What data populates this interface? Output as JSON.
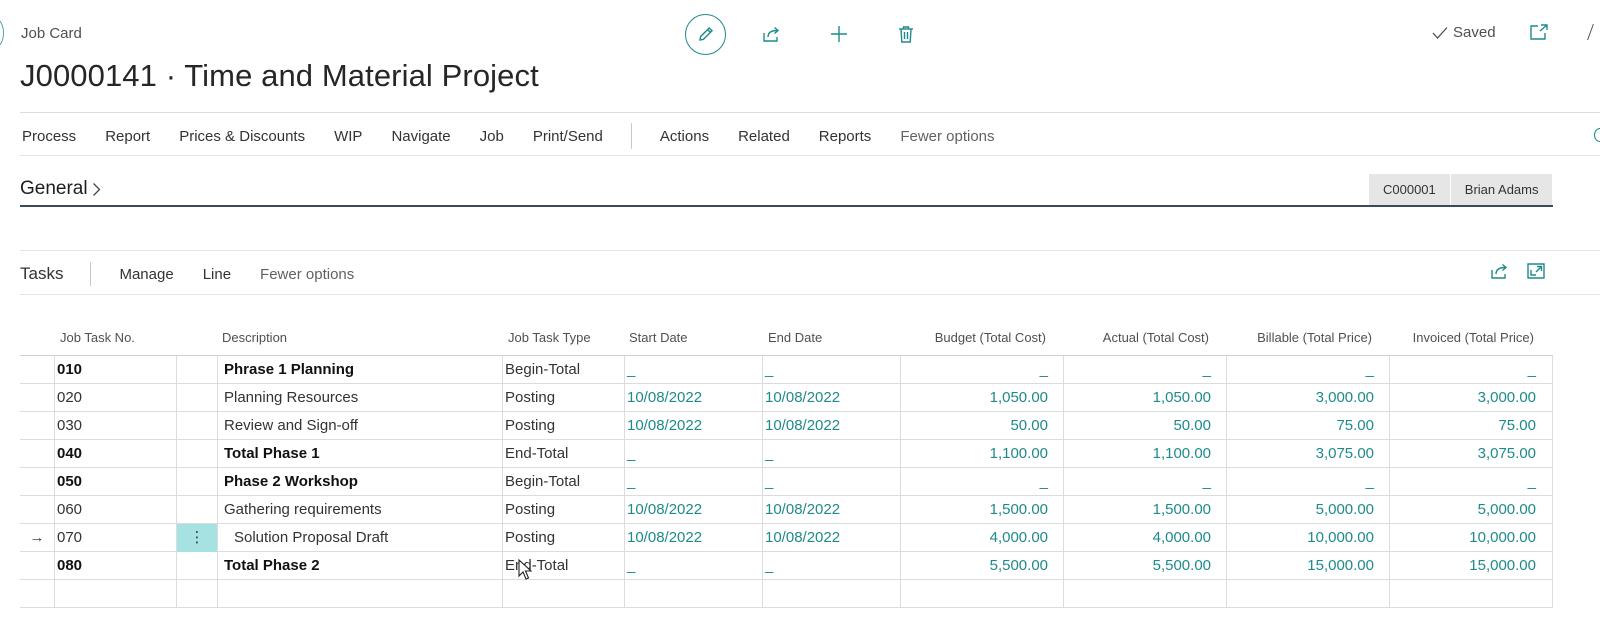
{
  "header": {
    "page_kind": "Job Card",
    "title": "J0000141 · Time and Material Project",
    "saved_label": "Saved"
  },
  "action_bar": {
    "items": [
      "Process",
      "Report",
      "Prices & Discounts",
      "WIP",
      "Navigate",
      "Job",
      "Print/Send"
    ],
    "secondary": [
      "Actions",
      "Related",
      "Reports",
      "Fewer options"
    ]
  },
  "general": {
    "title": "General",
    "chips": [
      "C000001",
      "Brian Adams"
    ]
  },
  "tasks": {
    "title": "Tasks",
    "actions": [
      "Manage",
      "Line",
      "Fewer options"
    ],
    "columns": [
      "Job Task No.",
      "Description",
      "Job Task Type",
      "Start Date",
      "End Date",
      "Budget (Total Cost)",
      "Actual (Total Cost)",
      "Billable (Total Price)",
      "Invoiced (Total Price)"
    ],
    "rows": [
      {
        "no": "010",
        "desc": "Phrase 1 Planning",
        "type": "Begin-Total",
        "start": "_",
        "end": "_",
        "budget": "_",
        "actual": "_",
        "billable": "_",
        "invoiced": "_"
      },
      {
        "no": "020",
        "desc": "Planning Resources",
        "type": "Posting",
        "start": "10/08/2022",
        "end": "10/08/2022",
        "budget": "1,050.00",
        "actual": "1,050.00",
        "billable": "3,000.00",
        "invoiced": "3,000.00"
      },
      {
        "no": "030",
        "desc": "Review and Sign-off",
        "type": "Posting",
        "start": "10/08/2022",
        "end": "10/08/2022",
        "budget": "50.00",
        "actual": "50.00",
        "billable": "75.00",
        "invoiced": "75.00"
      },
      {
        "no": "040",
        "desc": "Total Phase 1",
        "type": "End-Total",
        "start": "_",
        "end": "_",
        "budget": "1,100.00",
        "actual": "1,100.00",
        "billable": "3,075.00",
        "invoiced": "3,075.00"
      },
      {
        "no": "050",
        "desc": "Phase 2 Workshop",
        "type": "Begin-Total",
        "start": "_",
        "end": "_",
        "budget": "_",
        "actual": "_",
        "billable": "_",
        "invoiced": "_"
      },
      {
        "no": "060",
        "desc": "Gathering requirements",
        "type": "Posting",
        "start": "10/08/2022",
        "end": "10/08/2022",
        "budget": "1,500.00",
        "actual": "1,500.00",
        "billable": "5,000.00",
        "invoiced": "5,000.00"
      },
      {
        "no": "070",
        "desc": "Solution Proposal Draft",
        "type": "Posting",
        "start": "10/08/2022",
        "end": "10/08/2022",
        "budget": "4,000.00",
        "actual": "4,000.00",
        "billable": "10,000.00",
        "invoiced": "10,000.00"
      },
      {
        "no": "080",
        "desc": "Total Phase 2",
        "type": "End-Total",
        "start": "_",
        "end": "_",
        "budget": "5,500.00",
        "actual": "5,500.00",
        "billable": "15,000.00",
        "invoiced": "15,000.00"
      }
    ],
    "row_arrow": "→",
    "row_menu": "⋮"
  },
  "icons": {
    "edit": "pencil-icon",
    "share": "share-icon",
    "new": "plus-icon",
    "delete": "trash-icon",
    "saved": "check-icon",
    "popout": "open-in-new-window-icon",
    "general_expand": "chevron-right-icon",
    "tasks_share": "share-icon",
    "tasks_expand": "expand-icon"
  },
  "colors": {
    "accent": "#1f8a8a",
    "selected_cell": "#a6e2e2"
  }
}
